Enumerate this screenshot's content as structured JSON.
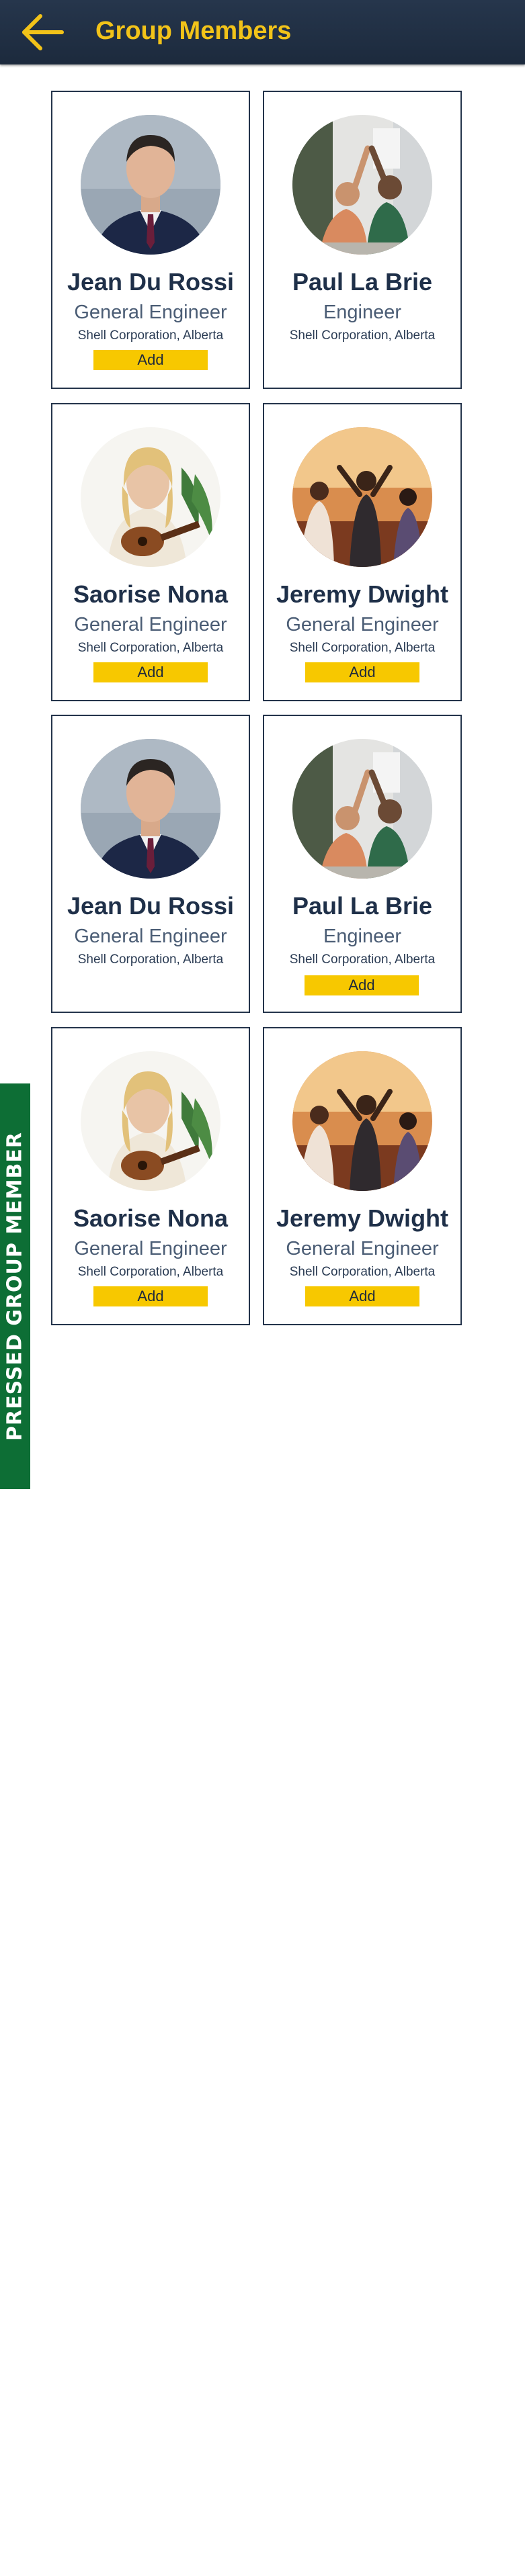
{
  "header": {
    "title": "Group Members",
    "back_icon": "arrow-left-icon",
    "accent_color": "#f2c319",
    "background_color": "#1f2d40"
  },
  "members": [
    {
      "name": "Jean Du Rossi",
      "role": "General Engineer",
      "company": "Shell Corporation, Alberta",
      "add_label": "Add",
      "photo": "man-in-suit-portrait"
    },
    {
      "name": "Paul La Brie",
      "role": "Engineer",
      "company": "Shell Corporation, Alberta",
      "add_label": "",
      "photo": "friends-high-five"
    },
    {
      "name": "Saorise Nona",
      "role": "General Engineer",
      "company": "Shell Corporation, Alberta",
      "add_label": "Add",
      "photo": "woman-with-ukulele"
    },
    {
      "name": "Jeremy Dwight",
      "role": "General Engineer",
      "company": "Shell Corporation, Alberta",
      "add_label": "Add",
      "photo": "friends-dancing-sunset"
    },
    {
      "name": "Jean Du Rossi",
      "role": "General Engineer",
      "company": "Shell Corporation, Alberta",
      "add_label": "",
      "photo": "man-in-suit-portrait"
    },
    {
      "name": "Paul La Brie",
      "role": "Engineer",
      "company": "Shell Corporation, Alberta",
      "add_label": "Add",
      "photo": "friends-high-five"
    },
    {
      "name": "Saorise Nona",
      "role": "General Engineer",
      "company": "Shell Corporation, Alberta",
      "add_label": "Add",
      "photo": "woman-with-ukulele"
    },
    {
      "name": "Jeremy Dwight",
      "role": "General Engineer",
      "company": "Shell Corporation, Alberta",
      "add_label": "Add",
      "photo": "friends-dancing-sunset"
    }
  ],
  "side_tab": {
    "label": "PRESSED GROUP MEMBER",
    "color": "#0d6e35"
  },
  "colors": {
    "add_button": "#f7c800",
    "card_border": "#24344b",
    "name_text": "#1f3049"
  }
}
